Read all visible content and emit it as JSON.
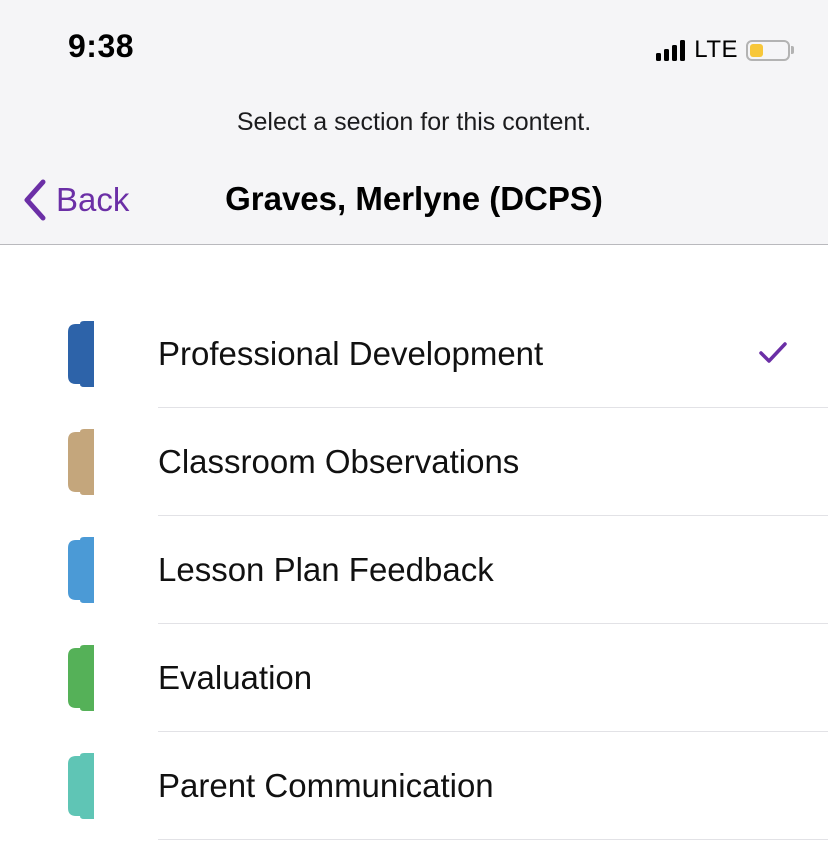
{
  "status_bar": {
    "time": "9:38",
    "network": "LTE",
    "battery_level": 0.35
  },
  "header": {
    "prompt": "Select a section for this content.",
    "back_label": "Back",
    "title": "Graves, Merlyne (DCPS)"
  },
  "colors": {
    "accent": "#6b2fa6"
  },
  "sections": [
    {
      "label": "Professional Development",
      "color": "#2d63a9",
      "selected": true,
      "icon": "section-tab-icon"
    },
    {
      "label": "Classroom Observations",
      "color": "#c4a67c",
      "selected": false,
      "icon": "section-tab-icon"
    },
    {
      "label": "Lesson Plan Feedback",
      "color": "#4b9ad6",
      "selected": false,
      "icon": "section-tab-icon"
    },
    {
      "label": "Evaluation",
      "color": "#55b158",
      "selected": false,
      "icon": "section-tab-icon"
    },
    {
      "label": "Parent Communication",
      "color": "#5fc5b5",
      "selected": false,
      "icon": "section-tab-icon"
    }
  ]
}
